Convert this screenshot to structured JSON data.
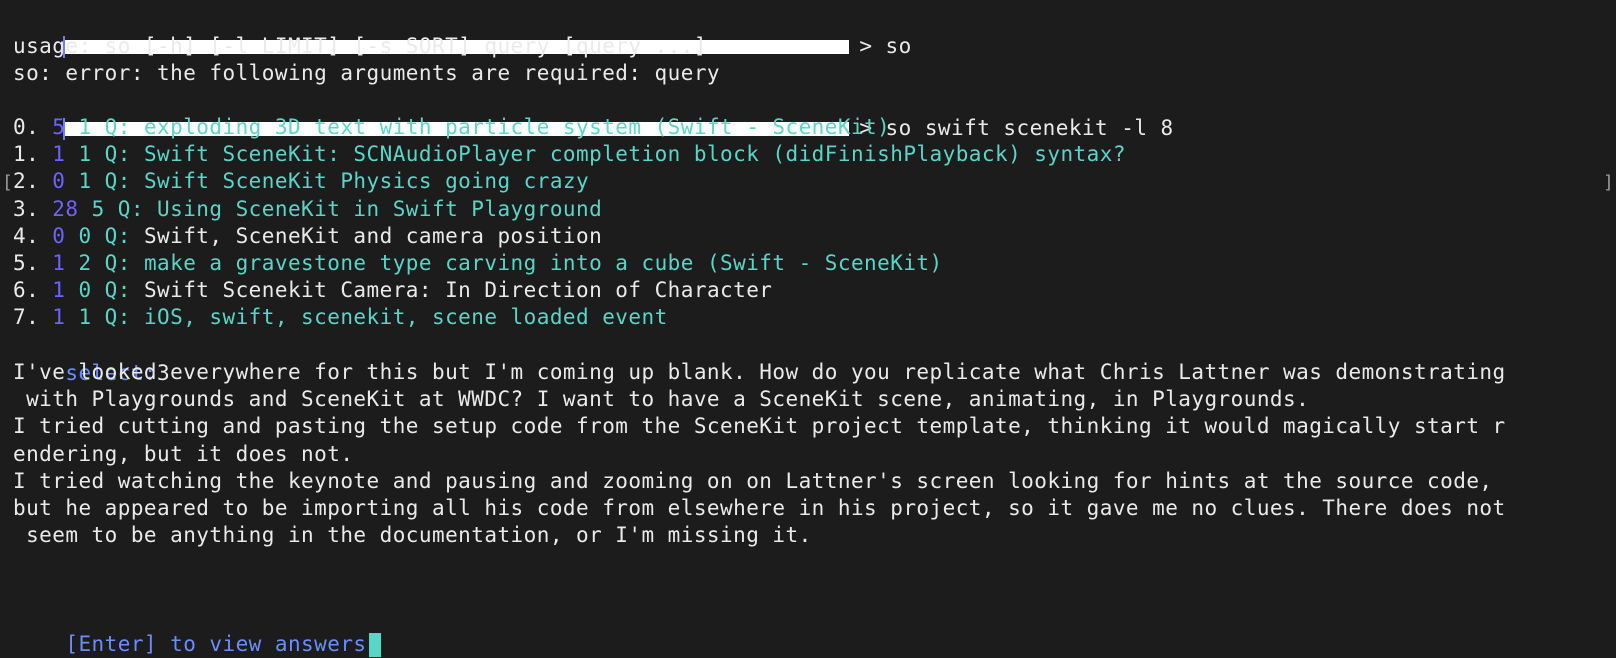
{
  "terminal": {
    "command_1": "> so",
    "usage_line": "usage: so [-h] [-l LIMIT] [-s SORT] query [query ...]",
    "error_line": "so: error: the following arguments are required: query",
    "command_2": "> so swift scenekit -l 8",
    "results": [
      {
        "index": "0.",
        "votes": "5",
        "answers": "1",
        "q": "Q:",
        "title": "exploding 3D text with particle system (Swift - SceneKit)",
        "title_color": "cyan"
      },
      {
        "index": "1.",
        "votes": "1",
        "answers": "1",
        "q": "Q:",
        "title": "Swift SceneKit: SCNAudioPlayer completion block (didFinishPlayback) syntax?",
        "title_color": "cyan"
      },
      {
        "index": "2.",
        "votes": "0",
        "answers": "1",
        "q": "Q:",
        "title": "Swift SceneKit Physics going crazy",
        "title_color": "cyan"
      },
      {
        "index": "3.",
        "votes": "28",
        "answers": "5",
        "q": "Q:",
        "title": "Using SceneKit in Swift Playground",
        "title_color": "cyan"
      },
      {
        "index": "4.",
        "votes": "0",
        "answers": "0",
        "q": "Q:",
        "title": "Swift, SceneKit and camera position",
        "title_color": "white"
      },
      {
        "index": "5.",
        "votes": "1",
        "answers": "2",
        "q": "Q:",
        "title": "make a gravestone type carving into a cube (Swift - SceneKit)",
        "title_color": "cyan"
      },
      {
        "index": "6.",
        "votes": "1",
        "answers": "0",
        "q": "Q:",
        "title": "Swift Scenekit Camera: In Direction of Character",
        "title_color": "white"
      },
      {
        "index": "7.",
        "votes": "1",
        "answers": "1",
        "q": "Q:",
        "title": "iOS, swift, scenekit, scene loaded event",
        "title_color": "cyan"
      }
    ],
    "select_label": "select:",
    "select_value": "3",
    "question_body": [
      "I've looked everywhere for this but I'm coming up blank. How do you replicate what Chris Lattner was demonstrating",
      " with Playgrounds and SceneKit at WWDC? I want to have a SceneKit scene, animating, in Playgrounds.",
      "I tried cutting and pasting the setup code from the SceneKit project template, thinking it would magically start r",
      "endering, but it does not.",
      "I tried watching the keynote and pausing and zooming on on Lattner's screen looking for hints at the source code,",
      "but he appeared to be importing all his code from elsewhere in his project, so it gave me no clues. There does not",
      " seem to be anything in the documentation, or I'm missing it."
    ],
    "footer": "[Enter] to view answers"
  },
  "colors": {
    "background": "#1c1c1c",
    "text": "#eaeaea",
    "cyan": "#59d6c8",
    "votes": "#6b63ff",
    "accent_blue": "#6b8cff",
    "redaction": "#ffffff"
  }
}
